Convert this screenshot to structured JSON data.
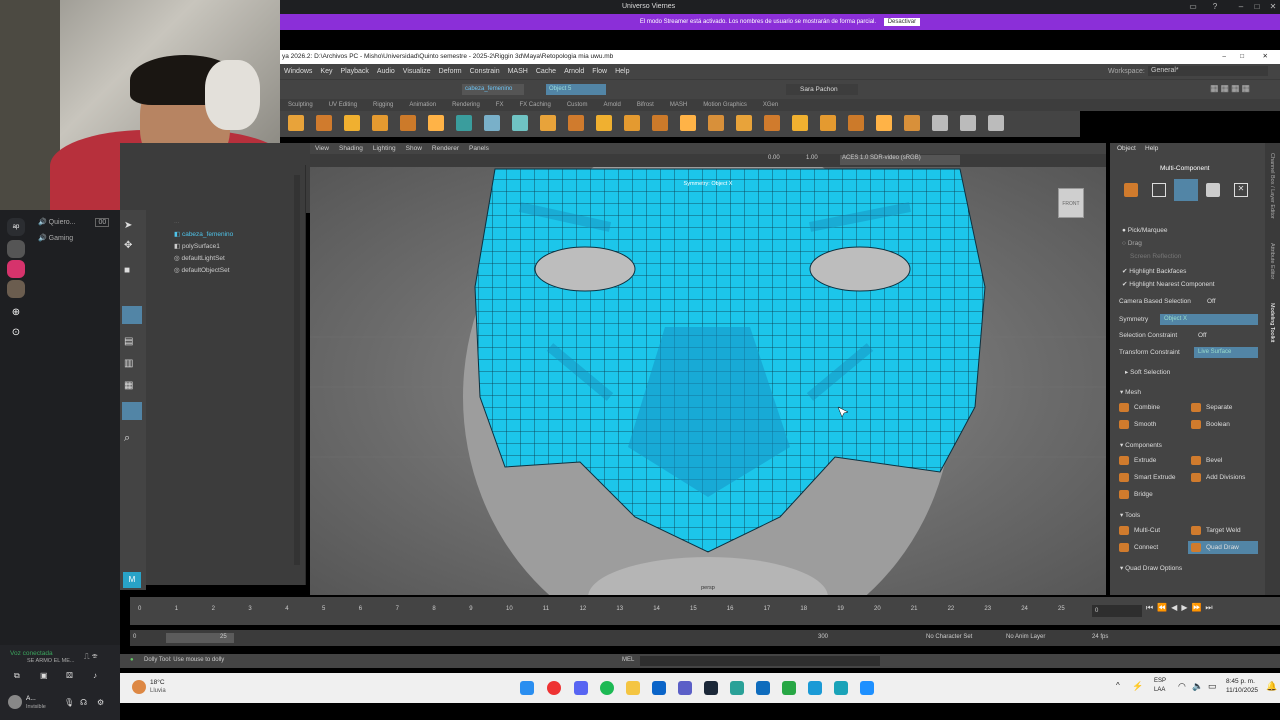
{
  "discord": {
    "window_title": "Universo Viernes",
    "streamer_notice": "El modo Streamer está activado. Los nombres de usuario se mostrarán de forma parcial.",
    "streamer_button": "Desactivar",
    "guild_label": "ap",
    "channels": [
      "Quiero...",
      "Gaming"
    ],
    "channel_count": "00",
    "voice_status": "Voz conectada",
    "voice_channel": "SE ARMO EL ME...",
    "user_name": "A...",
    "user_status": "Invisible"
  },
  "maya": {
    "title": "ya 2026.2: D:\\Archivos PC - Misho\\Universidad\\Quinto semestre - 2025-2\\Riggin 3d\\Maya\\Retopologia mia uwu.mb",
    "menu": [
      "Windows",
      "Key",
      "Playback",
      "Audio",
      "Visualize",
      "Deform",
      "Constrain",
      "MASH",
      "Cache",
      "Arnold",
      "Flow",
      "Help"
    ],
    "workspace_label": "Workspace:",
    "workspace_value": "General*",
    "status_object": "cabeza_femenino",
    "status_field": "Object 5",
    "user_account": "Sara Pachon",
    "shelf_tabs": [
      "Sculpting",
      "UV Editing",
      "Rigging",
      "Animation",
      "Rendering",
      "FX",
      "FX Caching",
      "Custom",
      "Arnold",
      "Bifrost",
      "MASH",
      "Motion Graphics",
      "XGen"
    ],
    "panel_menu": [
      "View",
      "Shading",
      "Lighting",
      "Show",
      "Renderer",
      "Panels"
    ],
    "panel_values": {
      "exposure": "0.00",
      "gamma": "1.00",
      "colorspace": "ACES 1.0 SDR-video (sRGB)"
    },
    "viewport_label": "Symmetry: Object X",
    "camera_label": "persp",
    "view_cube": "FRONT",
    "outliner": [
      "...",
      "cabeza_femenino",
      "polySurface1",
      "defaultLightSet",
      "defaultObjectSet"
    ],
    "right_panel": {
      "tabs": [
        "Object",
        "Help"
      ],
      "mode": "Multi-Component",
      "pick_marquee": "Pick/Marquee",
      "drag": "Drag",
      "screen_reflection": "Screen Reflection",
      "highlight_backfaces": "Highlight Backfaces",
      "highlight_nearest": "Highlight Nearest Component",
      "camera_based": "Camera Based Selection",
      "camera_based_val": "Off",
      "symmetry": "Symmetry",
      "symmetry_val": "Object X",
      "sel_constraint": "Selection Constraint",
      "sel_constraint_val": "Off",
      "transform_constraint": "Transform Constraint",
      "transform_constraint_val": "Live Surface",
      "soft_selection": "Soft Selection",
      "sec_mesh": "Mesh",
      "combine": "Combine",
      "separate": "Separate",
      "smooth": "Smooth",
      "boolean": "Boolean",
      "sec_components": "Components",
      "extrude": "Extrude",
      "bevel": "Bevel",
      "smart_extrude": "Smart Extrude",
      "add_divisions": "Add Divisions",
      "bridge": "Bridge",
      "sec_tools": "Tools",
      "multi_cut": "Multi-Cut",
      "target_weld": "Target Weld",
      "connect": "Connect",
      "quad_draw": "Quad Draw",
      "quad_draw_options": "Quad Draw Options"
    },
    "side_strip": [
      "Channel Box / Layer Editor",
      "Attribute Editor",
      "Modeling Toolkit"
    ],
    "timeline_ticks": [
      "0",
      "1",
      "2",
      "3",
      "4",
      "5",
      "6",
      "7",
      "8",
      "9",
      "10",
      "11",
      "12",
      "13",
      "14",
      "15",
      "16",
      "17",
      "18",
      "19",
      "20",
      "21",
      "22",
      "23",
      "24",
      "25"
    ],
    "current_frame": "0",
    "range": {
      "start": "0",
      "start2": "0",
      "end_inner": "25",
      "end_outer": "300",
      "no_char_set": "No Character Set",
      "no_anim_layer": "No Anim Layer",
      "fps": "24 fps"
    },
    "help_line": "Dolly Tool: Use mouse to dolly",
    "mel_label": "MEL"
  },
  "taskbar": {
    "weather_temp": "18°C",
    "weather_desc": "Lluvia",
    "lang": "ESP",
    "lang2": "LAA",
    "time": "8:45 p. m.",
    "date": "11/10/2025"
  },
  "colors": {
    "accent_purple": "#8b2fd8",
    "mesh_blue": "#19c6ea",
    "maya_blue": "#5285a6"
  }
}
